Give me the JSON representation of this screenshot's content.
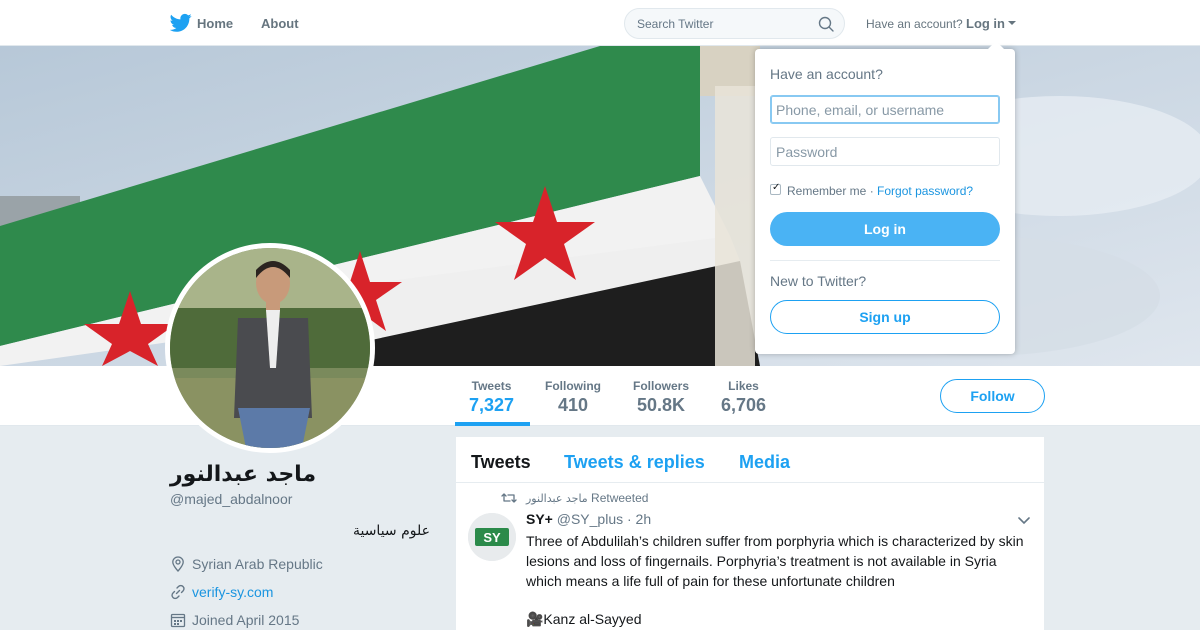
{
  "nav": {
    "logo_icon": "twitter-bird-icon",
    "home_label": "Home",
    "about_label": "About",
    "search_placeholder": "Search Twitter",
    "have_account_label": "Have an account?",
    "login_label": "Log in"
  },
  "profile": {
    "name": "ماجد عبدالنور",
    "handle": "@majed_abdalnoor",
    "bio": "علوم سياسية",
    "location": "Syrian Arab Republic",
    "website": "verify-sy.com",
    "joined": "Joined April 2015"
  },
  "stats": [
    {
      "label": "Tweets",
      "value": "7,327",
      "active": true
    },
    {
      "label": "Following",
      "value": "410"
    },
    {
      "label": "Followers",
      "value": "50.8K"
    },
    {
      "label": "Likes",
      "value": "6,706"
    }
  ],
  "follow_label": "Follow",
  "timeline": {
    "tabs": [
      "Tweets",
      "Tweets & replies",
      "Media"
    ],
    "retweeted_by": "ماجد عبدالنور",
    "retweeted_suffix": "Retweeted",
    "tweet": {
      "author": "SY+",
      "handle": "@SY_plus",
      "time": "· 2h",
      "avatar_text": "SY",
      "text": "Three of Abdulilah’s children suffer from porphyria which is characterized by skin lesions and loss of fingernails. Porphyria’s treatment is not available in Syria which means a life full of pain for these unfortunate children",
      "credit": "🎥Kanz al-Sayyed"
    }
  },
  "login_dropdown": {
    "title": "Have an account?",
    "phone_placeholder": "Phone, email, or username",
    "password_placeholder": "Password",
    "remember_label": "Remember me",
    "separator": "·",
    "forgot_label": "Forgot password?",
    "login_button": "Log in",
    "new_label": "New to Twitter?",
    "signup_button": "Sign up"
  },
  "colors": {
    "accent": "#1da1f2",
    "flag_green": "#2f8a4c",
    "flag_red": "#d8232a",
    "flag_black": "#1e1e1e"
  }
}
